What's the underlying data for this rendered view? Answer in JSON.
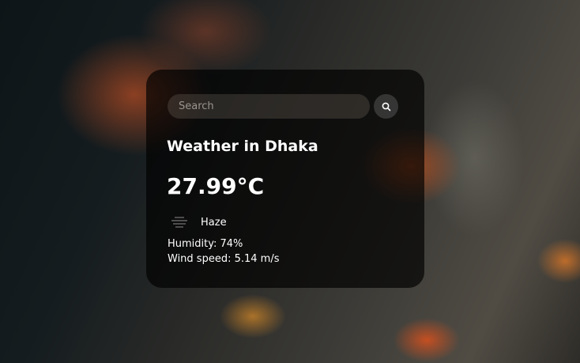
{
  "search": {
    "placeholder": "Search",
    "value": ""
  },
  "weather": {
    "title": "Weather in Dhaka",
    "temperature": "27.99°C",
    "condition": "Haze",
    "condition_icon": "haze-icon",
    "humidity": "Humidity: 74%",
    "wind": "Wind speed: 5.14 m/s"
  }
}
